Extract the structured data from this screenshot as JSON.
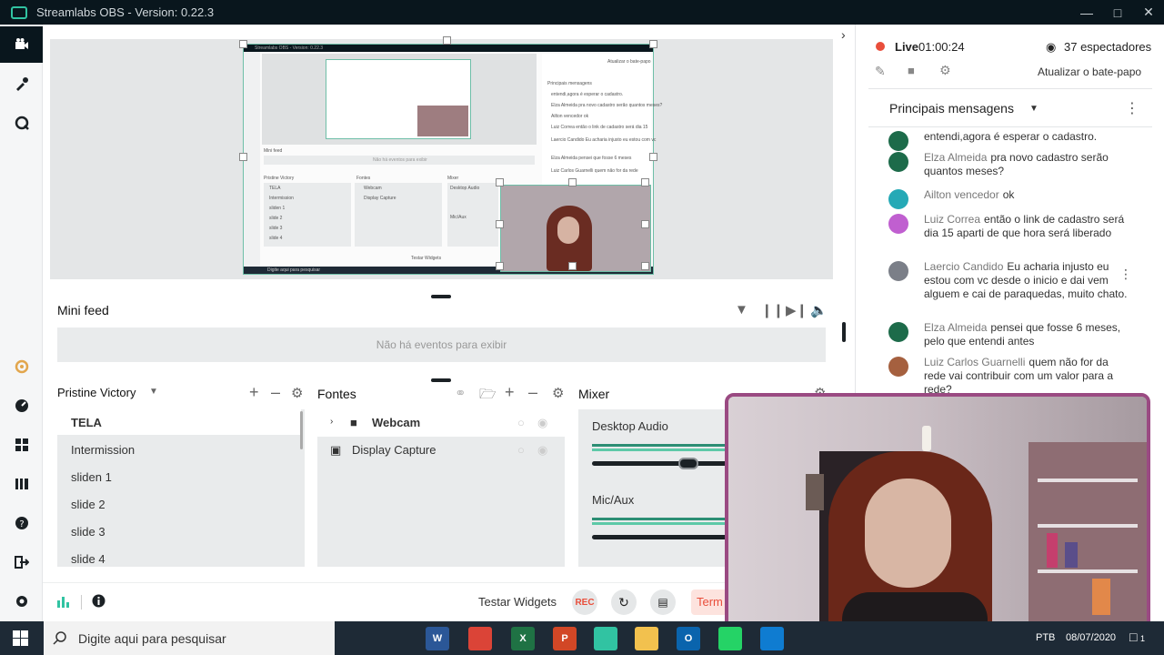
{
  "window": {
    "title": "Streamlabs OBS - Version: 0.22.3"
  },
  "colors": {
    "accent": "#31c3a2",
    "titlebar": "#09161d",
    "live_dot": "#e94e3b",
    "webcam_border": "#9a4a82"
  },
  "nav_icons": [
    "camera-icon",
    "themes-icon",
    "chatbot-icon",
    "prime-icon",
    "dashboard-icon",
    "layout-icon",
    "studio-mode-icon",
    "help-icon",
    "logout-icon",
    "settings-icon"
  ],
  "nested_preview": {
    "title": "Streamlabs OBS - Version: 0.22.3",
    "mini_feed": "Mini feed",
    "no_events": "Não há eventos para exibir",
    "scene_name": "Pristine Victory",
    "scenes": [
      "TELA",
      "Intermission",
      "sliden 1",
      "slide 2",
      "slide 3",
      "slide 4"
    ],
    "sources_title": "Fontes",
    "sources": [
      "Webcam",
      "Display Capture"
    ],
    "mixer": "Mixer",
    "audio": [
      "Desktop Audio",
      "Mic/Aux"
    ],
    "test_widgets": "Testar Widgets",
    "taskbar_search": "Digite aqui para pesquisar",
    "chat_header": "Principais mensagens",
    "chat_refresh": "Atualizar o bate-papo",
    "chat_lines": [
      "entendi,agora é esperar o cadastro.",
      "Elza Almeida pra novo cadastro serão quantos meses?",
      "Ailton vencedor ok",
      "Luiz Correa então o link de cadastro será dia 15",
      "Laercio Candido Eu acharia injusto eu estou com vc",
      "Elza Almeida pensei que fosse 6 meses",
      "Luiz Carlos Guarnelli quem não for da rede"
    ],
    "time": "08/07/2020",
    "lang": "PTB"
  },
  "mini_feed": {
    "title": "Mini feed",
    "empty": "Não há eventos para exibir"
  },
  "scenes": {
    "selector": "Pristine Victory",
    "items": [
      "TELA",
      "Intermission",
      "sliden 1",
      "slide 2",
      "slide 3",
      "slide 4"
    ]
  },
  "sources": {
    "title": "Fontes",
    "items": [
      "Webcam",
      "Display Capture"
    ]
  },
  "mixer": {
    "title": "Mixer",
    "channels": [
      {
        "name": "Desktop Audio",
        "volume": 0.75
      },
      {
        "name": "Mic/Aux",
        "volume": 0.9
      }
    ]
  },
  "bottom": {
    "test_widgets": "Testar Widgets",
    "rec": "REC",
    "go_live": "Term"
  },
  "chat": {
    "live_label": "Live",
    "live_time": "01:00:24",
    "viewers": "37 espectadores",
    "refresh": "Atualizar o bate-papo",
    "header": "Principais mensagens",
    "messages": [
      {
        "user": "",
        "text": "entendi,agora é esperar o cadastro.",
        "avatar": "#1d6b4a"
      },
      {
        "user": "Elza Almeida",
        "text": "pra novo cadastro serão quantos meses?",
        "avatar": "#1d6b4a"
      },
      {
        "user": "Ailton vencedor",
        "text": "ok",
        "avatar": "#25a9b6"
      },
      {
        "user": "Luiz Correa",
        "text": "então o link de cadastro será dia 15 aparti de que hora será liberado",
        "avatar": "#c05fd0"
      },
      {
        "user": "Laercio Candido",
        "text": "Eu acharia injusto eu estou com vc desde o inicio e dai vem alguem e cai de paraquedas, muito chato.",
        "avatar": "#7b7f88"
      },
      {
        "user": "Elza Almeida",
        "text": "pensei que fosse 6 meses, pelo que entendi antes",
        "avatar": "#1d6b4a"
      },
      {
        "user": "Luiz Carlos Guarnelli",
        "text": "quem não for da rede vai contribuir com um valor para a rede?",
        "avatar": "#a5603f"
      }
    ]
  },
  "taskbar": {
    "search_placeholder": "Digite aqui para pesquisar",
    "lang": "PTB",
    "date": "08/07/2020",
    "notif_count": "1",
    "apps": [
      {
        "name": "cortana",
        "label": "",
        "color": "#1e2a36"
      },
      {
        "name": "taskview",
        "label": "",
        "color": "#1e2a36"
      },
      {
        "name": "word",
        "label": "W",
        "color": "#2b5797"
      },
      {
        "name": "chrome",
        "label": "",
        "color": "#db4437"
      },
      {
        "name": "excel",
        "label": "X",
        "color": "#1f7244"
      },
      {
        "name": "powerpoint",
        "label": "P",
        "color": "#d24726"
      },
      {
        "name": "streamlabs",
        "label": "",
        "color": "#31c3a2"
      },
      {
        "name": "explorer",
        "label": "",
        "color": "#f2c14e"
      },
      {
        "name": "outlook",
        "label": "O",
        "color": "#0a64ad"
      },
      {
        "name": "whatsapp",
        "label": "",
        "color": "#25d366"
      },
      {
        "name": "edge",
        "label": "",
        "color": "#0f7cd1"
      }
    ]
  }
}
